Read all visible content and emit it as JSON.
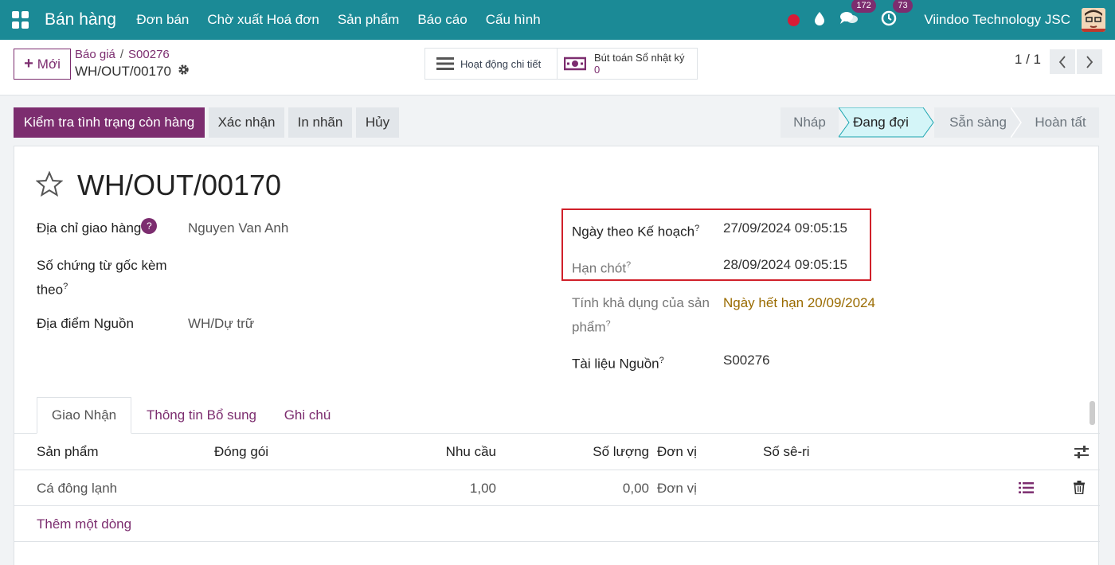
{
  "navbar": {
    "app_name": "Bán hàng",
    "menu": [
      "Đơn bán",
      "Chờ xuất Hoá đơn",
      "Sản phẩm",
      "Báo cáo",
      "Cấu hình"
    ],
    "messages_count": "172",
    "activities_count": "73",
    "company": "Viindoo Technology JSC",
    "colors": {
      "navbar": "#1b8a96",
      "brand": "#7c2d6f",
      "record_dot": "#d81b36"
    }
  },
  "control": {
    "new_label": "Mới",
    "breadcrumb": [
      "Báo giá",
      "S00276"
    ],
    "record_name": "WH/OUT/00170",
    "smart_activity": "Hoạt động chi tiết",
    "smart_journal_label": "Bút toán Sổ nhật ký",
    "smart_journal_count": "0",
    "pager": "1 / 1"
  },
  "actions": {
    "check_availability": "Kiểm tra tình trạng còn hàng",
    "validate": "Xác nhận",
    "print_labels": "In nhãn",
    "cancel": "Hủy"
  },
  "status": {
    "stages": [
      "Nháp",
      "Đang đợi",
      "Sẵn sàng",
      "Hoàn tất"
    ],
    "current": "Đang đợi"
  },
  "form": {
    "title": "WH/OUT/00170",
    "delivery_address_label": "Địa chỉ giao hàng",
    "delivery_address_value": "Nguyen Van Anh",
    "origin_doc_label_1": "Số chứng từ gốc kèm",
    "origin_doc_label_2": "theo",
    "source_location_label": "Địa điểm Nguồn",
    "source_location_value": "WH/Dự trữ",
    "scheduled_date_label": "Ngày theo Kế hoạch",
    "scheduled_date_value": "27/09/2024 09:05:15",
    "deadline_label": "Hạn chót",
    "deadline_value": "28/09/2024 09:05:15",
    "availability_label_1": "Tính khả dụng của sản",
    "availability_label_2": "phẩm",
    "availability_value": "Ngày hết hạn 20/09/2024",
    "source_doc_label": "Tài liệu Nguồn",
    "source_doc_value": "S00276",
    "help_mark": "?"
  },
  "tabs": [
    "Giao Nhận",
    "Thông tin Bổ sung",
    "Ghi chú"
  ],
  "table": {
    "headers": [
      "Sản phẩm",
      "Đóng gói",
      "Nhu cầu",
      "Số lượng",
      "Đơn vị",
      "Số sê-ri"
    ],
    "rows": [
      {
        "product": "Cá đông lạnh",
        "demand": "1,00",
        "quantity": "0,00",
        "uom": "Đơn vị"
      }
    ],
    "add_line": "Thêm một dòng"
  }
}
